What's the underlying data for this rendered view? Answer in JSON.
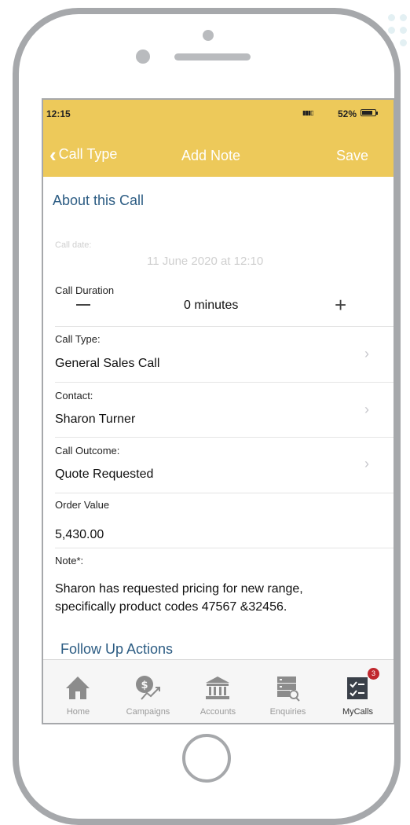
{
  "status_bar": {
    "time": "12:15",
    "battery": "52%"
  },
  "nav": {
    "back_label": "Call Type",
    "title": "Add Note",
    "save_label": "Save"
  },
  "sections": {
    "about": "About this Call",
    "follow_up": "Follow Up Actions"
  },
  "call_date": {
    "label": "Call date:",
    "value": "11 June 2020 at 12:10"
  },
  "call_duration": {
    "label": "Call Duration",
    "value": "0 minutes",
    "minus": "—",
    "plus": "+"
  },
  "call_type": {
    "label": "Call Type:",
    "value": "General Sales Call"
  },
  "contact": {
    "label": "Contact:",
    "value": "Sharon Turner"
  },
  "call_outcome": {
    "label": "Call Outcome:",
    "value": "Quote Requested"
  },
  "order_value": {
    "label": "Order Value",
    "value": "5,430.00"
  },
  "note": {
    "label": "Note*:",
    "value": "Sharon has requested pricing for new range, specifically product codes 47567 &32456."
  },
  "tabs": [
    {
      "label": "Home",
      "icon": "home-icon"
    },
    {
      "label": "Campaigns",
      "icon": "campaigns-icon"
    },
    {
      "label": "Accounts",
      "icon": "bank-icon"
    },
    {
      "label": "Enquiries",
      "icon": "enquiries-icon"
    },
    {
      "label": "MyCalls",
      "icon": "checklist-icon",
      "badge": "3",
      "active": true
    }
  ],
  "colors": {
    "header": "#edc95a",
    "section_title": "#2c5c83",
    "badge": "#c0272d"
  }
}
